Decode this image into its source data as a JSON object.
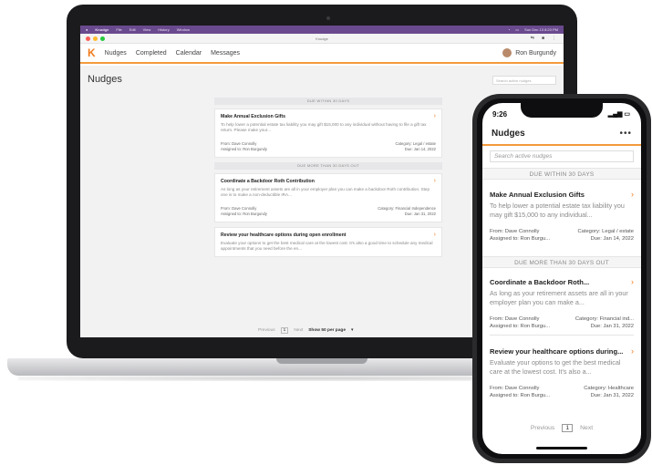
{
  "laptop": {
    "menubar": {
      "app": "Knudge",
      "menus": [
        "File",
        "Edit",
        "View",
        "History",
        "Window"
      ],
      "clock": "Sun Dec 13  8:23 PM"
    },
    "window_title": "Knudge",
    "nav": {
      "logo": "K",
      "links": [
        "Nudges",
        "Completed",
        "Calendar",
        "Messages"
      ],
      "user": "Ron Burgundy"
    },
    "page_title": "Nudges",
    "search_placeholder": "Search active nudges",
    "sections": [
      {
        "header": "DUE WITHIN 30 DAYS",
        "cards": [
          {
            "title": "Make Annual Exclusion Gifts",
            "desc": "To help lower a potential estate tax liability you may gift $15,000 to any individual without having to file a gift tax return. Please make your...",
            "from": "From: Dave Connolly",
            "assigned": "Assigned to: Ron Burgundy",
            "category": "Category: Legal / estate",
            "due": "Due: Jan 14, 2022"
          }
        ]
      },
      {
        "header": "DUE MORE THAN 30 DAYS OUT",
        "cards": [
          {
            "title": "Coordinate a Backdoor Roth Contribution",
            "desc": "As long as your retirement assets are all in your employer plan you can make a backdoor Roth contribution. Step one is to make a non-deductible IRA...",
            "from": "From: Dave Connolly",
            "assigned": "Assigned to: Ron Burgundy",
            "category": "Category: Financial Independence",
            "due": "Due: Jan 31, 2022"
          },
          {
            "title": "Review your healthcare options during open enrollment",
            "desc": "Evaluate your options to get the best medical care at the lowest cost. It's also a good time to schedule any medical appointments that you need before the en..."
          }
        ]
      }
    ],
    "pager": {
      "prev": "Previous",
      "page": "1",
      "next": "Next",
      "per_page": "Show 50 per page"
    }
  },
  "phone": {
    "time": "9:26",
    "title": "Nudges",
    "more": "•••",
    "search_placeholder": "Search active nudges",
    "sections": [
      {
        "header": "DUE WITHIN 30 DAYS",
        "cards": [
          {
            "title": "Make Annual Exclusion Gifts",
            "desc": "To help lower a potential estate tax liability you may gift $15,000 to any individual...",
            "from": "From: Dave Connolly",
            "assigned": "Assigned to: Ron Burgu...",
            "category": "Category: Legal / estate",
            "due": "Due: Jan 14, 2022"
          }
        ]
      },
      {
        "header": "DUE MORE THAN 30 DAYS OUT",
        "cards": [
          {
            "title": "Coordinate a Backdoor Roth...",
            "desc": "As long as your retirement assets are all in your employer plan you can make a...",
            "from": "From: Dave Connolly",
            "assigned": "Assigned to: Ron Burgu...",
            "category": "Category: Financial ind...",
            "due": "Due: Jan 31, 2022"
          },
          {
            "title": "Review your healthcare options during...",
            "desc": "Evaluate your options to get the best medical care at the lowest cost. It's also a...",
            "from": "From: Dave Connolly",
            "assigned": "Assigned to: Ron Burgu...",
            "category": "Category: Healthcare",
            "due": "Due: Jan 31, 2022"
          }
        ]
      }
    ],
    "pager": {
      "prev": "Previous",
      "page": "1",
      "next": "Next"
    }
  },
  "colors": {
    "accent": "#f07c1e",
    "menubar": "#6a4a8e"
  }
}
